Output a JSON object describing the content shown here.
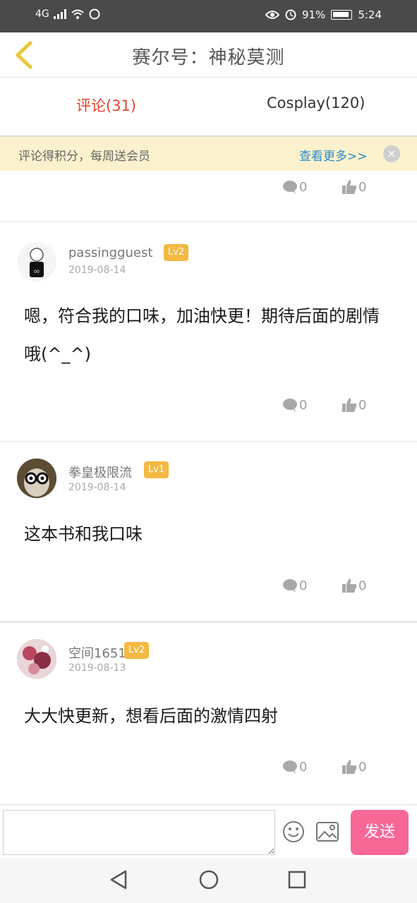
{
  "status_bar": {
    "network": "4G",
    "battery": "91%",
    "time": "5:24"
  },
  "header": {
    "back_icon": "chevron-left-icon",
    "title": "赛尔号：神秘莫测"
  },
  "tabs": [
    {
      "label": "评论(31)"
    },
    {
      "label": "Cosplay(120)"
    }
  ],
  "banner": {
    "text": "评论得积分，每周送会员",
    "more": "查看更多>>",
    "close": "×"
  },
  "comments": [
    {
      "username": "passingguest",
      "level": "Lv2",
      "date": "2019-08-14",
      "text": "嗯，符合我的口味，加油快更！期待后面的剧情哦(^_^)"
    },
    {
      "username": "拳皇极限流",
      "level": "Lv1",
      "date": "2019-08-14",
      "text": "这本书和我口味"
    },
    {
      "username": "空间1651",
      "level": "Lv2",
      "date": "2019-08-13",
      "text": "大大快更新，想看后面的激情四射"
    }
  ],
  "actions": {
    "reply_count": "0",
    "like_count": "0"
  },
  "input": {
    "placeholder": "",
    "send_label": "发送"
  },
  "colors": {
    "active_tab": "#e0442b",
    "banner_bg": "#fbf1cd",
    "link": "#2a8ac8",
    "level_badge": "#f4b942",
    "send_button": "#f76896"
  }
}
